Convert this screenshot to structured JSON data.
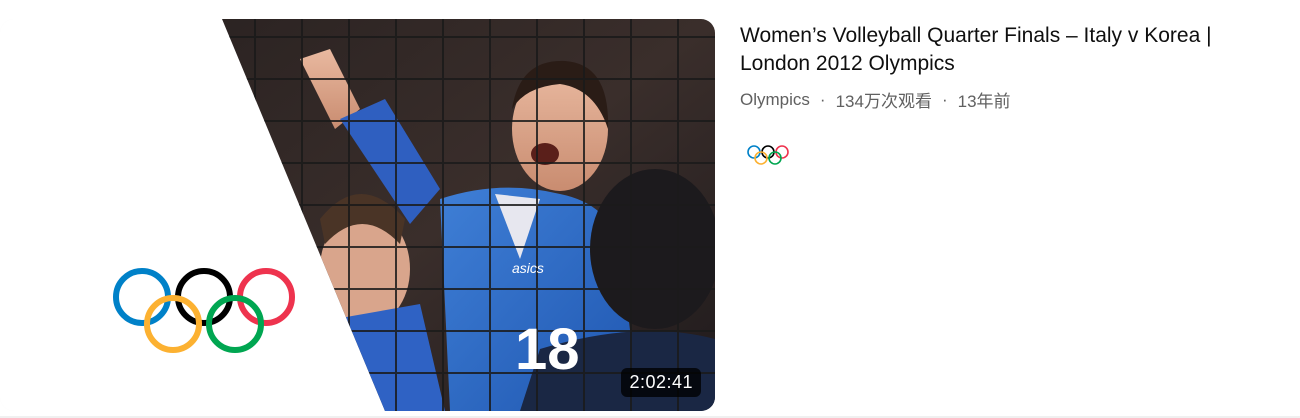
{
  "video": {
    "title_line1": "Women’s Volleyball Quarter Finals – Italy v Korea |",
    "title_line2": "London 2012 Olympics",
    "channel": "Olympics",
    "views": "134万次观看",
    "age": "13年前",
    "duration": "2:02:41",
    "separator": "·"
  },
  "thumbnail": {
    "jersey_brand": "asics",
    "jersey_number": "18",
    "ring_colors": [
      "#0081C8",
      "#FCB131",
      "#000000",
      "#00A651",
      "#EE334E"
    ]
  },
  "icons": {
    "logo": "olympic-rings-icon",
    "channel_avatar": "olympic-rings-icon"
  }
}
